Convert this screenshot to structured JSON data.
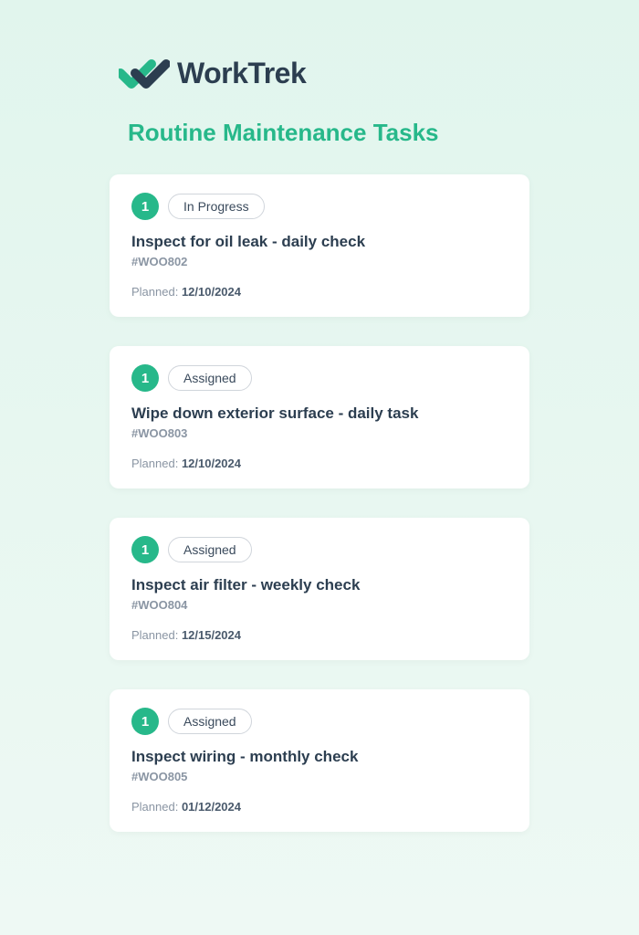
{
  "brand": {
    "name": "WorkTrek"
  },
  "page": {
    "title": "Routine Maintenance Tasks"
  },
  "labels": {
    "planned": "Planned: "
  },
  "tasks": [
    {
      "count": "1",
      "status": "In Progress",
      "title": "Inspect for oil leak - daily check",
      "id": "#WOO802",
      "planned_date": "12/10/2024"
    },
    {
      "count": "1",
      "status": "Assigned",
      "title": "Wipe down exterior surface - daily task",
      "id": "#WOO803",
      "planned_date": "12/10/2024"
    },
    {
      "count": "1",
      "status": "Assigned",
      "title": "Inspect air filter - weekly check",
      "id": "#WOO804",
      "planned_date": "12/15/2024"
    },
    {
      "count": "1",
      "status": "Assigned",
      "title": "Inspect wiring - monthly check",
      "id": "#WOO805",
      "planned_date": "01/12/2024"
    }
  ]
}
